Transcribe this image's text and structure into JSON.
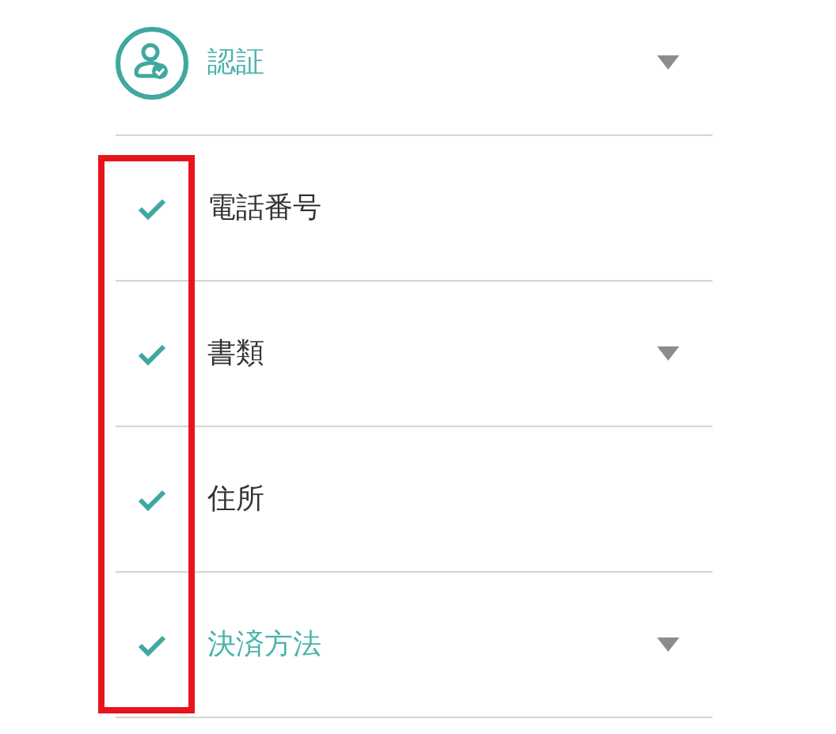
{
  "header": {
    "title": "認証",
    "expandable": true,
    "active": true
  },
  "steps": [
    {
      "label": "電話番号",
      "checked": true,
      "expandable": false,
      "active": false
    },
    {
      "label": "書類",
      "checked": true,
      "expandable": true,
      "active": false
    },
    {
      "label": "住所",
      "checked": true,
      "expandable": false,
      "active": false
    },
    {
      "label": "決済方法",
      "checked": true,
      "expandable": true,
      "active": true
    }
  ],
  "annotation": {
    "kind": "outline"
  }
}
